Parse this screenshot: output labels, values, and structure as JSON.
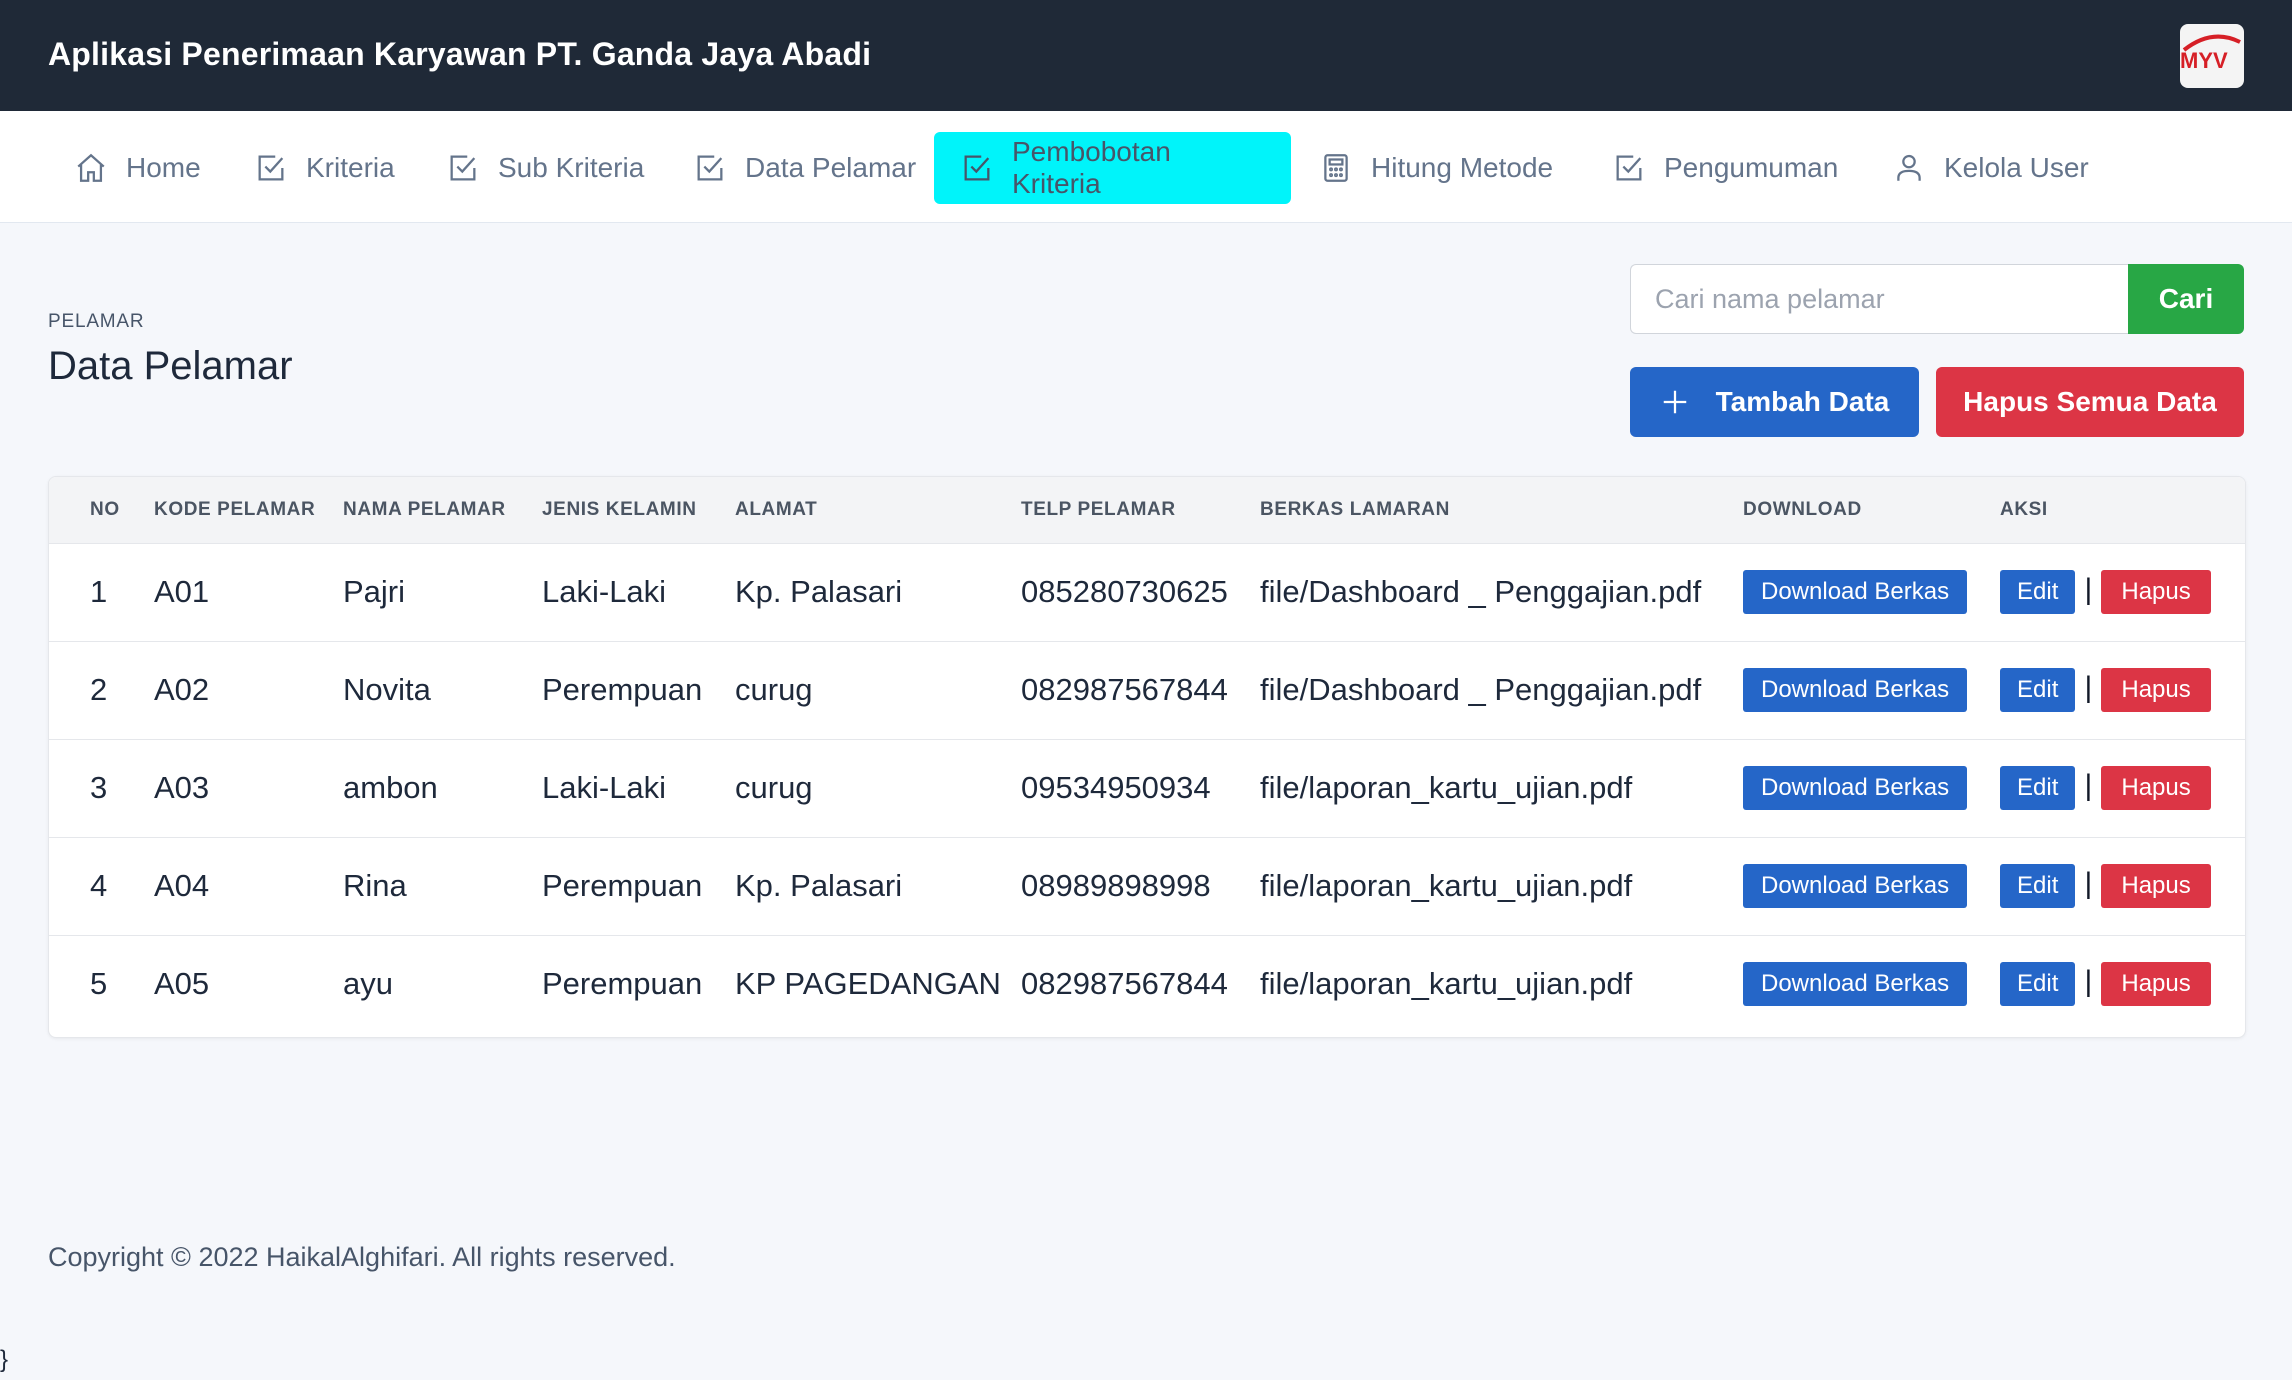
{
  "header": {
    "title": "Aplikasi Penerimaan Karyawan PT. Ganda Jaya Abadi",
    "logo_text": "MYV"
  },
  "nav": {
    "items": [
      {
        "label": "Home",
        "icon": "home-icon"
      },
      {
        "label": "Kriteria",
        "icon": "check-square-icon"
      },
      {
        "label": "Sub Kriteria",
        "icon": "check-square-icon"
      },
      {
        "label": "Data Pelamar",
        "icon": "check-square-icon"
      },
      {
        "label": "Pembobotan Kriteria",
        "icon": "check-square-icon",
        "active": true
      },
      {
        "label": "Hitung Metode",
        "icon": "calculator-icon"
      },
      {
        "label": "Pengumuman",
        "icon": "check-square-icon"
      },
      {
        "label": "Kelola User",
        "icon": "user-icon"
      }
    ]
  },
  "page": {
    "eyebrow": "PELAMAR",
    "title": "Data Pelamar"
  },
  "search": {
    "placeholder": "Cari nama pelamar",
    "value": "",
    "button_label": "Cari"
  },
  "actions": {
    "add_label": "Tambah Data",
    "delete_all_label": "Hapus Semua Data"
  },
  "table": {
    "columns": [
      "NO",
      "KODE PELAMAR",
      "NAMA PELAMAR",
      "JENIS KELAMIN",
      "ALAMAT",
      "TELP PELAMAR",
      "BERKAS LAMARAN",
      "DOWNLOAD",
      "AKSI"
    ],
    "rows": [
      {
        "no": "1",
        "kode": "A01",
        "nama": "Pajri",
        "jk": "Laki-Laki",
        "alamat": "Kp. Palasari",
        "telp": "085280730625",
        "berkas": "file/Dashboard _ Penggajian.pdf"
      },
      {
        "no": "2",
        "kode": "A02",
        "nama": "Novita",
        "jk": "Perempuan",
        "alamat": "curug",
        "telp": "082987567844",
        "berkas": "file/Dashboard _ Penggajian.pdf"
      },
      {
        "no": "3",
        "kode": "A03",
        "nama": "ambon",
        "jk": "Laki-Laki",
        "alamat": "curug",
        "telp": "09534950934",
        "berkas": "file/laporan_kartu_ujian.pdf"
      },
      {
        "no": "4",
        "kode": "A04",
        "nama": "Rina",
        "jk": "Perempuan",
        "alamat": "Kp. Palasari",
        "telp": "08989898998",
        "berkas": "file/laporan_kartu_ujian.pdf"
      },
      {
        "no": "5",
        "kode": "A05",
        "nama": "ayu",
        "jk": "Perempuan",
        "alamat": "KP PAGEDANGAN",
        "telp": "082987567844",
        "berkas": "file/laporan_kartu_ujian.pdf"
      }
    ],
    "download_label": "Download Berkas",
    "edit_label": "Edit",
    "separator": "|",
    "delete_label": "Hapus"
  },
  "footer": {
    "text": "Copyright © 2022 HaikalAlghifari. All rights reserved.",
    "stray": "}"
  },
  "colors": {
    "header_bg": "#1f2937",
    "active_nav": "#00f4fa",
    "primary": "#2566c8",
    "success": "#28a745",
    "danger": "#dc3545"
  }
}
